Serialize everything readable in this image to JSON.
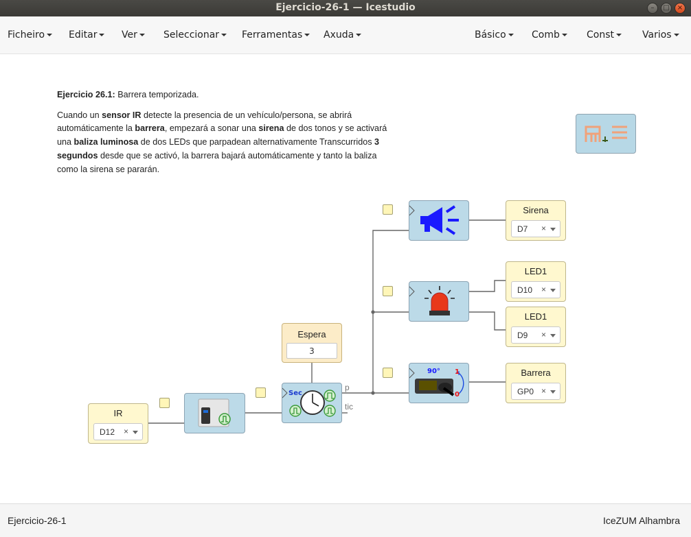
{
  "window": {
    "title": "Ejercicio-26-1 — Icestudio"
  },
  "menubar": {
    "left": [
      "Ficheiro",
      "Editar",
      "Ver",
      "Seleccionar",
      "Ferramentas",
      "Axuda"
    ],
    "right": [
      "Básico",
      "Comb",
      "Const",
      "Varios"
    ]
  },
  "info": {
    "title_bold": "Ejercicio 26.1:",
    "title_rest": " Barrera temporizada.",
    "p_a": "Cuando un ",
    "p_b": "sensor IR",
    "p_c": " detecte la presencia de un vehículo/persona, se abrirá automáticamente la ",
    "p_d": "barrera",
    "p_e": ", empezará a sonar una ",
    "p_f": "sirena",
    "p_g": " de dos tonos y se activará una ",
    "p_h": "baliza luminosa",
    "p_i": " de dos LEDs que parpadean alternativamente Transcurridos ",
    "p_j": "3 segundos",
    "p_k": " desde que se activó, la barrera bajará automáticamente y tanto la baliza como la sirena se pararán."
  },
  "inputs": [
    {
      "label": "IR",
      "value": "D12"
    }
  ],
  "outputs": [
    {
      "label": "Sirena",
      "value": "D7"
    },
    {
      "label": "LED1",
      "value": "D10"
    },
    {
      "label": "LED1",
      "value": "D9"
    },
    {
      "label": "Barrera",
      "value": "GP0"
    }
  ],
  "param": {
    "label": "Espera",
    "value": "3"
  },
  "timer_block": {
    "text": "Sec",
    "port_p": "p",
    "port_tic": "tic"
  },
  "servo_block": {
    "angle": "90°",
    "one": "1",
    "zero": "0"
  },
  "statusbar": {
    "left": "Ejercicio-26-1",
    "right": "IceZUM Alhambra"
  },
  "colors": {
    "block_bg": "#bcdae8",
    "io_bg": "#fff8cf",
    "param_bg": "#fcecc8",
    "speaker_blue": "#1a1aff",
    "beacon_red": "#e8381a"
  },
  "icons": {
    "speaker": "speaker-icon",
    "beacon": "beacon-light-icon",
    "servo": "servo-motor-icon",
    "ir_sensor": "ir-sensor-icon",
    "timer": "stopwatch-icon"
  }
}
